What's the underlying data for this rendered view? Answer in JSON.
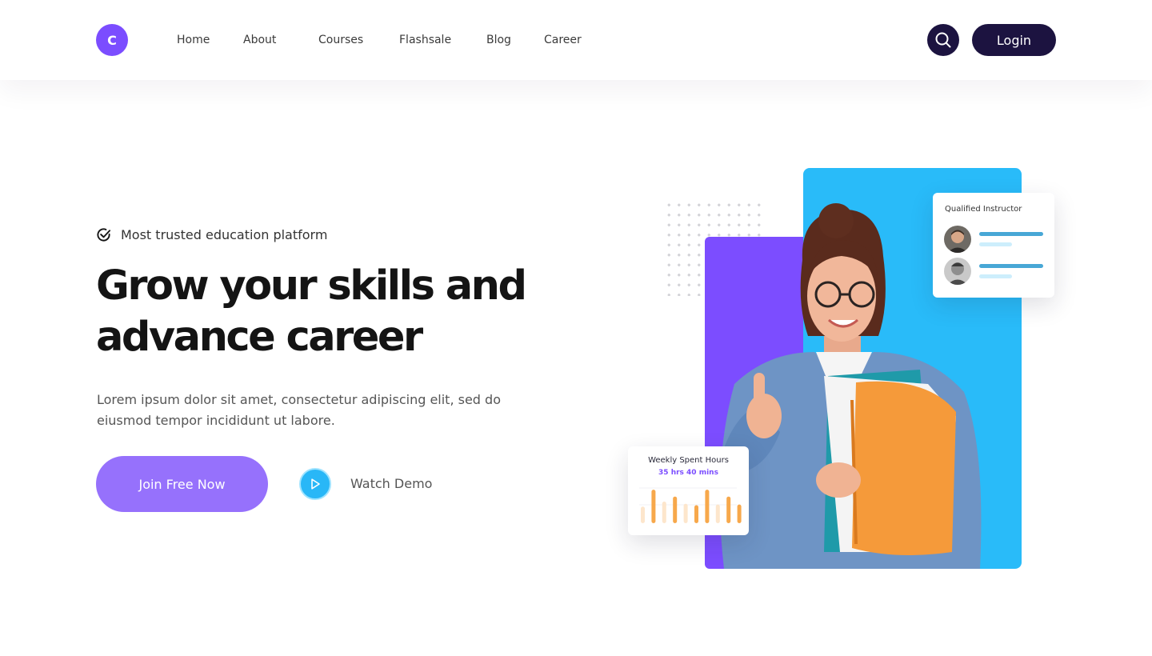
{
  "header": {
    "logo_letter": "C",
    "nav": [
      "Home",
      "About",
      "Courses",
      "Flashsale",
      "Blog",
      "Career"
    ],
    "login_label": "Login"
  },
  "hero": {
    "badge": "Most trusted education platform",
    "title_line1": "Grow your skills and",
    "title_line2": "advance career",
    "description": "Lorem ipsum dolor sit amet, consectetur adipiscing elit, sed do eiusmod tempor incididunt ut labore.",
    "join_label": "Join Free Now",
    "watch_label": "Watch Demo"
  },
  "instructor_card": {
    "title": "Qualified Instructor"
  },
  "weekly_card": {
    "title": "Weekly Spent Hours",
    "subtitle": "35 hrs 40 mins",
    "bars": [
      {
        "value": 0.46,
        "highlight": false
      },
      {
        "value": 0.93,
        "highlight": true
      },
      {
        "value": 0.6,
        "highlight": false
      },
      {
        "value": 0.74,
        "highlight": true
      },
      {
        "value": 0.54,
        "highlight": false
      },
      {
        "value": 0.5,
        "highlight": true
      },
      {
        "value": 0.93,
        "highlight": true
      },
      {
        "value": 0.52,
        "highlight": false
      },
      {
        "value": 0.74,
        "highlight": true
      },
      {
        "value": 0.52,
        "highlight": true
      }
    ]
  },
  "colors": {
    "brand_purple": "#7b4dff",
    "dark_navy": "#1c1340",
    "join_purple": "#9671fc",
    "sky_blue": "#29bbf9",
    "bar_orange": "#f7a84b",
    "bar_light": "#fde6cc"
  }
}
